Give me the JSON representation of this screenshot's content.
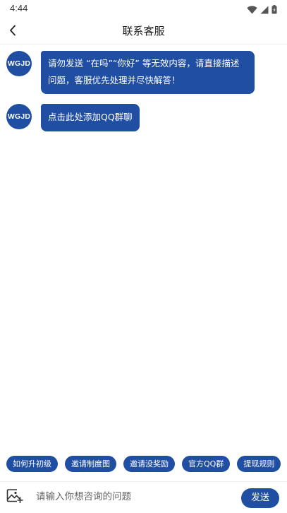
{
  "status_bar": {
    "time": "4:44",
    "icons": [
      "wifi-icon",
      "signal-icon",
      "battery-icon"
    ]
  },
  "header": {
    "title": "联系客服",
    "back_icon": "chevron-left-icon"
  },
  "messages": [
    {
      "avatar_text": "WGJD",
      "text": "请勿发送 “在吗”“你好” 等无效内容，请直接描述问题，客服优先处理并尽快解答！"
    },
    {
      "avatar_text": "WGJD",
      "text": "点击此处添加QQ群聊"
    }
  ],
  "quick_replies": [
    "如何升初级",
    "邀请制度图",
    "邀请没奖励",
    "官方QQ群",
    "提现规则"
  ],
  "input_bar": {
    "image_icon": "image-add-icon",
    "placeholder": "请输入你想咨询的问题",
    "value": "",
    "send_label": "发送"
  },
  "colors": {
    "accent": "#1f4ea3",
    "background": "#ffffff"
  }
}
